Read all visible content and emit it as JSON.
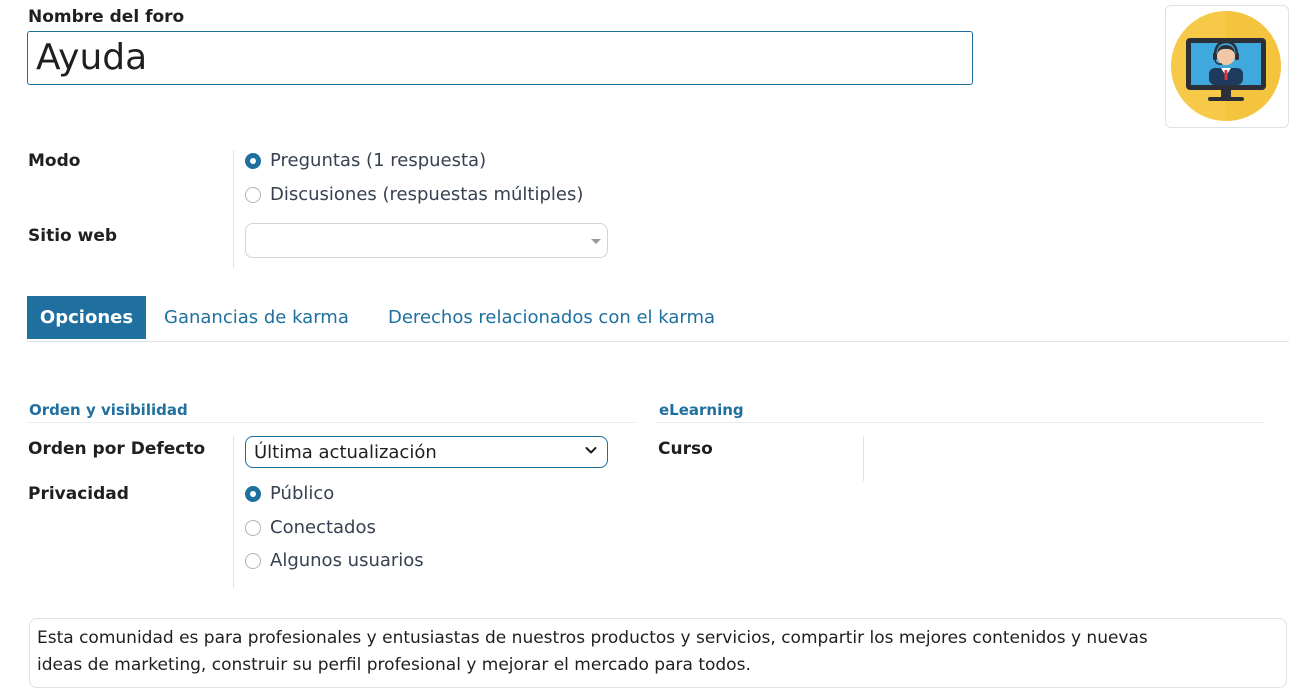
{
  "forum": {
    "name_label": "Nombre del foro",
    "name_value": "Ayuda",
    "avatar_icon": "support-agent-monitor-icon"
  },
  "mode": {
    "label": "Modo",
    "options": [
      {
        "label": "Preguntas (1 respuesta)",
        "checked": true
      },
      {
        "label": "Discusiones (respuestas múltiples)",
        "checked": false
      }
    ]
  },
  "website": {
    "label": "Sitio web",
    "value": ""
  },
  "tabs": [
    {
      "label": "Opciones",
      "active": true
    },
    {
      "label": "Ganancias de karma",
      "active": false
    },
    {
      "label": "Derechos relacionados con el karma",
      "active": false
    }
  ],
  "order_section": {
    "title": "Orden y visibilidad",
    "default_order_label": "Orden por Defecto",
    "default_order_value": "Última actualización",
    "privacy_label": "Privacidad",
    "privacy_options": [
      {
        "label": "Público",
        "checked": true
      },
      {
        "label": "Conectados",
        "checked": false
      },
      {
        "label": "Algunos usuarios",
        "checked": false
      }
    ]
  },
  "elearning_section": {
    "title": "eLearning",
    "course_label": "Curso",
    "course_value": ""
  },
  "description": {
    "line1": "Esta comunidad es para profesionales y entusiastas de nuestros productos y servicios, compartir los mejores contenidos y nuevas",
    "line2": "ideas de marketing, construir su perfil profesional y mejorar el mercado para todos."
  },
  "colors": {
    "accent": "#1f6f9f",
    "avatar_bg": "#f7c948",
    "border": "#dee2e6"
  }
}
